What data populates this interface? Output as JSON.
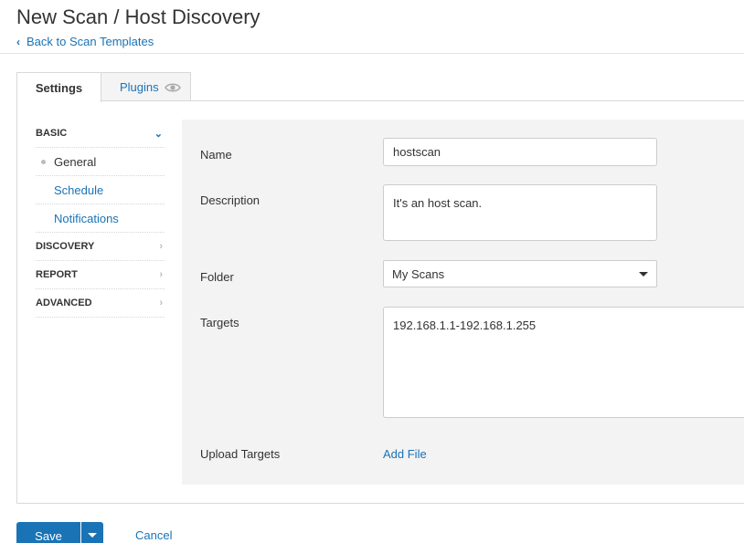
{
  "header": {
    "title": "New Scan / Host Discovery",
    "back_label": "Back to Scan Templates"
  },
  "tabs": [
    {
      "label": "Settings",
      "active": true
    },
    {
      "label": "Plugins",
      "active": false,
      "icon": "eye-icon"
    }
  ],
  "sidebar": {
    "sections": [
      {
        "label": "BASIC",
        "expanded": true
      },
      {
        "label": "DISCOVERY",
        "expanded": false
      },
      {
        "label": "REPORT",
        "expanded": false
      },
      {
        "label": "ADVANCED",
        "expanded": false
      }
    ],
    "basic_items": [
      {
        "label": "General",
        "active": true
      },
      {
        "label": "Schedule",
        "active": false
      },
      {
        "label": "Notifications",
        "active": false
      }
    ]
  },
  "form": {
    "name_label": "Name",
    "name_value": "hostscan",
    "description_label": "Description",
    "description_value": "It's an host scan.",
    "folder_label": "Folder",
    "folder_value": "My Scans",
    "targets_label": "Targets",
    "targets_value": "192.168.1.1-192.168.1.255",
    "upload_label": "Upload Targets",
    "add_file_label": "Add File"
  },
  "actions": {
    "save_label": "Save",
    "cancel_label": "Cancel"
  },
  "colors": {
    "accent": "#1a73b5",
    "form_bg": "#f3f3f3"
  }
}
